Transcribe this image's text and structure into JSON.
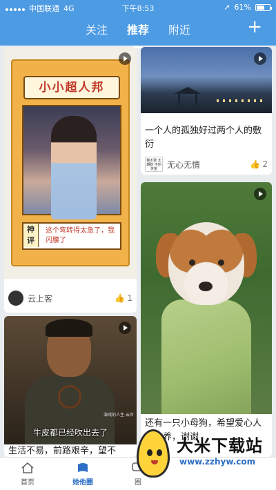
{
  "status_bar": {
    "carrier": "中国联通",
    "network": "4G",
    "time": "下午8:53",
    "battery": "61%",
    "battery_level": 0.61
  },
  "header": {
    "tabs": [
      {
        "label": "关注",
        "active": false
      },
      {
        "label": "推荐",
        "active": true
      },
      {
        "label": "附近",
        "active": false
      }
    ],
    "add_icon": "plus-icon"
  },
  "feed": {
    "card1": {
      "banner": "小小超人邦",
      "tag": "神评",
      "caption": "这个弯转得太急了，我闪腰了",
      "author": "云上客",
      "likes": "1"
    },
    "card2": {
      "title": "一个人的孤独好过两个人的敷衍",
      "avatar_text": "我不敢 太期盼 不怕失望",
      "author": "无心无情",
      "likes": "2"
    },
    "card3": {
      "title": "还有一只小母狗，希望爱心人士收养，谢谢"
    },
    "card4": {
      "subtitle": "牛皮都已经吹出去了",
      "side_text": "演戏的人生 云台",
      "title": "生活不易，前路艰辛，望不"
    }
  },
  "bottom_nav": [
    {
      "label": "首页",
      "icon": "home-icon",
      "active": false
    },
    {
      "label": "她他圈",
      "icon": "circle-icon",
      "active": true
    },
    {
      "label": "圈",
      "icon": "chat-icon",
      "active": false
    }
  ],
  "watermark": {
    "name": "大米下载站",
    "url": "www.zzhyw.com"
  },
  "colors": {
    "accent": "#4d9be3",
    "nav_active": "#2d6fc4"
  }
}
